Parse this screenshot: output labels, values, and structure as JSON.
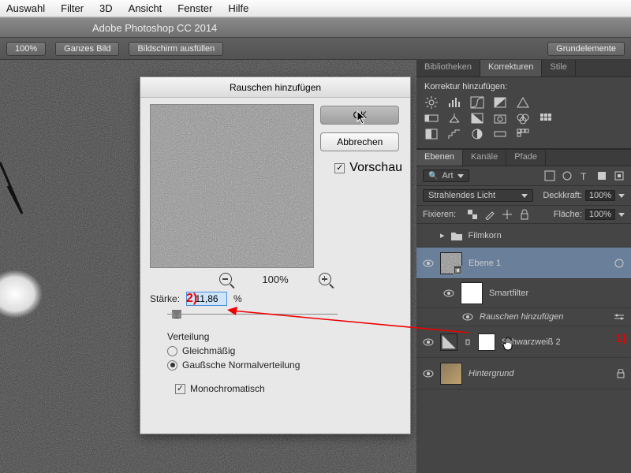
{
  "menubar": {
    "items": [
      "Auswahl",
      "Filter",
      "3D",
      "Ansicht",
      "Fenster",
      "Hilfe"
    ]
  },
  "titlebar": "Adobe Photoshop CC 2014",
  "toolbar": {
    "zoom": "100%",
    "fit_screen": "Ganzes Bild",
    "fill_screen": "Bildschirm ausfüllen",
    "essentials": "Grundelemente"
  },
  "dialog": {
    "title": "Rauschen hinzufügen",
    "ok": "OK",
    "cancel": "Abbrechen",
    "preview_chk": "Vorschau",
    "zoom_pct": "100%",
    "strength_label": "Stärke:",
    "strength_value": "11,86",
    "strength_unit": "%",
    "distribution_label": "Verteilung",
    "dist_uniform": "Gleichmäßig",
    "dist_gaussian": "Gaußsche Normalverteilung",
    "monochrome": "Monochromatisch"
  },
  "annotations": {
    "one": "1)",
    "two": "2)"
  },
  "panels": {
    "top_tabs": [
      "Bibliotheken",
      "Korrekturen",
      "Stile"
    ],
    "adjustments_title": "Korrektur hinzufügen:",
    "layer_tabs": [
      "Ebenen",
      "Kanäle",
      "Pfade"
    ],
    "kind_label": "Art",
    "blend_mode": "Strahlendes Licht",
    "opacity_label": "Deckkraft:",
    "opacity_value": "100%",
    "lock_label": "Fixieren:",
    "fill_label": "Fläche:",
    "fill_value": "100%",
    "layers": {
      "group": "Filmkorn",
      "l1": "Ebene 1",
      "smart": "Smartfilter",
      "noise_filter": "Rauschen hinzufügen",
      "bw": "Schwarzweiß 2",
      "bg": "Hintergrund"
    }
  }
}
